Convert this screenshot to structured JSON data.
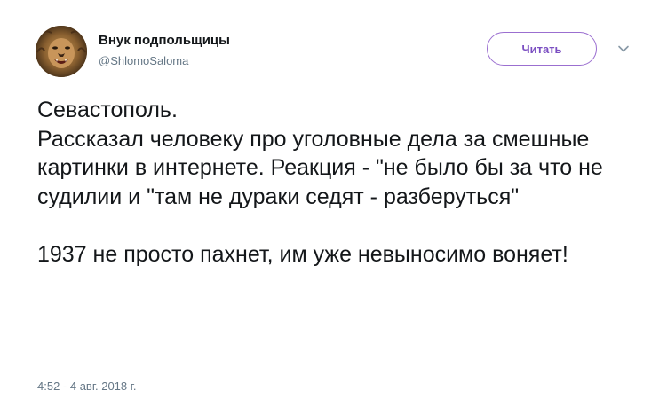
{
  "author": {
    "display_name": "Внук подпольщицы",
    "username": "@ShlomoSaloma",
    "avatar_icon": "lion-avatar"
  },
  "follow_button": {
    "label": "Читать"
  },
  "menu_icon": "chevron-down-icon",
  "tweet": {
    "text": "Севастополь.\nРассказал человеку про уголовные дела за смешные картинки в интернете. Реакция - \"не было бы за что не судилии и \"там не дураки седят - разберуться\"\n\n1937 не просто пахнет, им уже невыносимо воняет!",
    "timestamp": "4:52 - 4 авг. 2018 г."
  },
  "colors": {
    "accent": "#7b4fc2",
    "accent_border": "#9b6fd0",
    "text": "#14171a",
    "muted": "#657786"
  }
}
